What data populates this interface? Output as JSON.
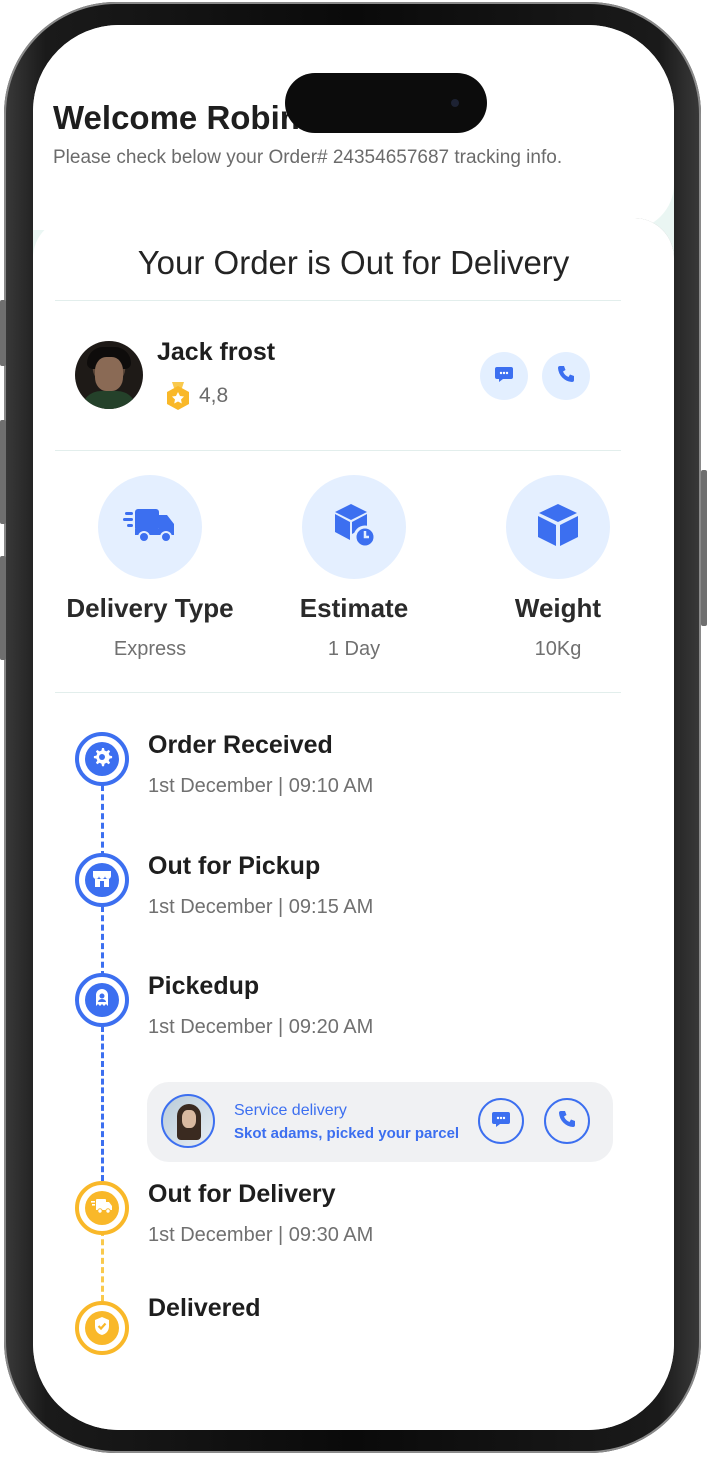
{
  "header": {
    "welcome": "Welcome Robin!",
    "subtitle": "Please check below your Order# 24354657687 tracking info."
  },
  "card": {
    "title": "Your Order is Out for Delivery"
  },
  "driver": {
    "name": "Jack frost",
    "rating": "4,8",
    "chat_icon": "chat-bubble-icon",
    "phone_icon": "phone-icon"
  },
  "stats": [
    {
      "icon": "delivery-truck-icon",
      "label": "Delivery Type",
      "value": "Express"
    },
    {
      "icon": "box-clock-icon",
      "label": "Estimate",
      "value": "1 Day"
    },
    {
      "icon": "box-icon",
      "label": "Weight",
      "value": "10Kg"
    }
  ],
  "timeline": [
    {
      "icon": "gear-icon",
      "title": "Order Received",
      "time": "1st December | 09:10 AM",
      "status": "done"
    },
    {
      "icon": "store-icon",
      "title": "Out for Pickup",
      "time": "1st December | 09:15 AM",
      "status": "done"
    },
    {
      "icon": "package-icon",
      "title": "Pickedup",
      "time": "1st December | 09:20 AM",
      "status": "done"
    },
    {
      "icon": "truck-icon",
      "title": "Out for Delivery",
      "time": "1st December | 09:30 AM",
      "status": "current"
    },
    {
      "icon": "check-shield-icon",
      "title": "Delivered",
      "time": "",
      "status": "pending"
    }
  ],
  "service": {
    "label": "Service delivery",
    "text": "Skot adams, picked your parcel"
  },
  "colors": {
    "primary": "#3c6ff0",
    "accent": "#f9b829",
    "light_blue": "#e4efff",
    "mint": "#eaf6f3"
  }
}
